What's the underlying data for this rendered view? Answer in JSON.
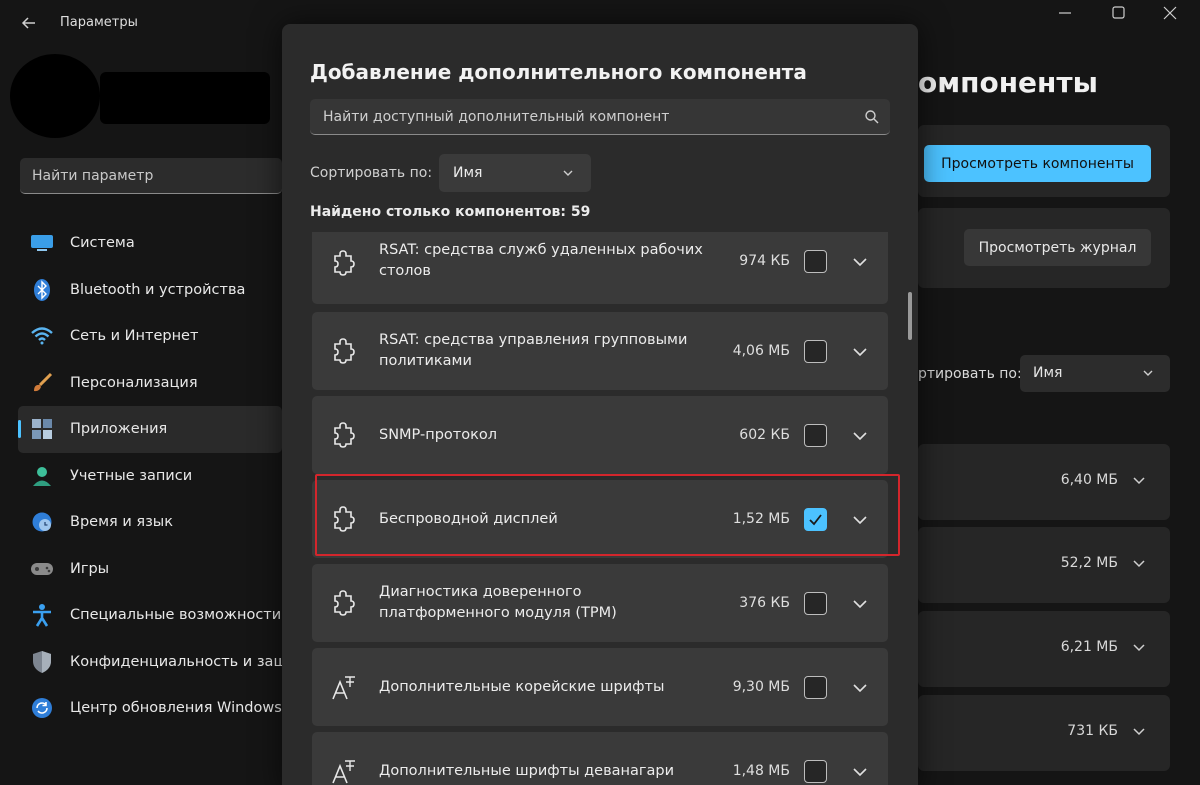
{
  "window": {
    "title": "Параметры"
  },
  "sidebar": {
    "search_placeholder": "Найти параметр",
    "items": [
      {
        "label": "Система",
        "icon": "monitor-icon"
      },
      {
        "label": "Bluetooth и устройства",
        "icon": "bluetooth-icon"
      },
      {
        "label": "Сеть и Интернет",
        "icon": "wifi-icon"
      },
      {
        "label": "Персонализация",
        "icon": "brush-icon"
      },
      {
        "label": "Приложения",
        "icon": "apps-icon",
        "active": true
      },
      {
        "label": "Учетные записи",
        "icon": "user-icon"
      },
      {
        "label": "Время и язык",
        "icon": "globe-clock-icon"
      },
      {
        "label": "Игры",
        "icon": "gamepad-icon"
      },
      {
        "label": "Специальные возможности",
        "icon": "accessibility-icon"
      },
      {
        "label": "Конфиденциальность и защ",
        "icon": "shield-icon"
      },
      {
        "label": "Центр обновления Windows",
        "icon": "update-icon"
      }
    ]
  },
  "background_page": {
    "heading": "омпоненты",
    "view_components_label": "Просмотреть компоненты",
    "view_log_label": "Просмотреть журнал",
    "sort_label": "ртировать по:",
    "sort_value": "Имя",
    "rows": [
      "6,40 МБ",
      "52,2 МБ",
      "6,21 МБ",
      "731 КБ"
    ]
  },
  "dialog": {
    "title": "Добавление дополнительного компонента",
    "search_placeholder": "Найти доступный дополнительный компонент",
    "sort_label": "Сортировать по:",
    "sort_value": "Имя",
    "found_text": "Найдено столько компонентов: 59",
    "items": [
      {
        "name": "RSAT: средства служб удаленных рабочих столов",
        "size": "974 КБ",
        "checked": false,
        "icon": "puzzle-icon"
      },
      {
        "name": "RSAT: средства управления групповыми политиками",
        "size": "4,06 МБ",
        "checked": false,
        "icon": "puzzle-icon"
      },
      {
        "name": "SNMP-протокол",
        "size": "602 КБ",
        "checked": false,
        "icon": "puzzle-icon"
      },
      {
        "name": "Беспроводной дисплей",
        "size": "1,52 МБ",
        "checked": true,
        "icon": "puzzle-icon"
      },
      {
        "name": "Диагностика доверенного платформенного модуля (TPM)",
        "size": "376 КБ",
        "checked": false,
        "icon": "puzzle-icon"
      },
      {
        "name": "Дополнительные корейские шрифты",
        "size": "9,30 МБ",
        "checked": false,
        "icon": "font-icon"
      },
      {
        "name": "Дополнительные шрифты деванагари",
        "size": "1,48 МБ",
        "checked": false,
        "icon": "font-icon"
      }
    ]
  },
  "colors": {
    "accent": "#4cc2ff",
    "highlight": "#d3262c",
    "dialog_bg": "#2b2b2b",
    "item_bg": "#3a3a3a"
  }
}
